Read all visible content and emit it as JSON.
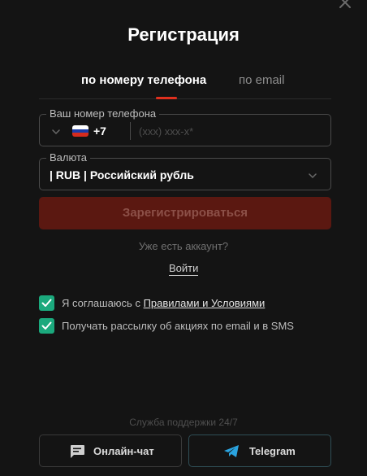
{
  "header": {
    "title": "Регистрация"
  },
  "tabs": [
    {
      "label": "по номеру телефона",
      "active": true
    },
    {
      "label": "по email",
      "active": false
    }
  ],
  "phone_field": {
    "label": "Ваш номер телефона",
    "country_flag": "russia-flag",
    "dial_code": "+7",
    "value": "",
    "placeholder": "(xxx) xxx-x*"
  },
  "currency_field": {
    "label": "Валюта",
    "value": "| RUB | Российский рубль"
  },
  "register_button": {
    "label": "Зарегистрироваться",
    "enabled": false
  },
  "login_prompt": {
    "text": "Уже есть аккаунт?",
    "link_label": "Войти"
  },
  "agreements": [
    {
      "prefix": "Я соглашаюсь с ",
      "link_label": "Правилами и Условиями",
      "checked": true
    },
    {
      "text": "Получать рассылку об акциях по email и в SMS",
      "checked": true
    }
  ],
  "support": {
    "label": "Служба поддержки 24/7",
    "buttons": [
      {
        "label": "Онлайн-чат",
        "icon": "chat-icon"
      },
      {
        "label": "Telegram",
        "icon": "telegram-icon"
      }
    ]
  },
  "colors": {
    "background": "#141414",
    "accent": "#e0301e",
    "register_disabled_bg": "#5b1811",
    "checkbox": "#1ba97d",
    "telegram": "#2aa3df"
  }
}
